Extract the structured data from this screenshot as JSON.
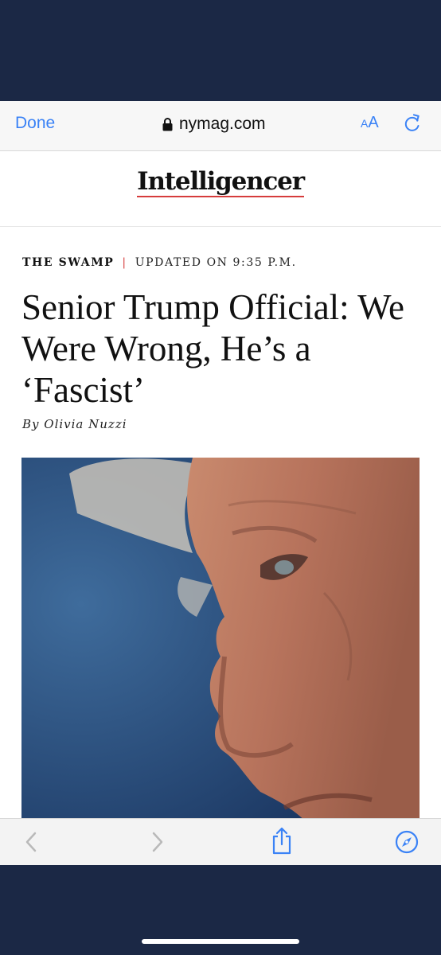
{
  "browser": {
    "done_label": "Done",
    "url": "nymag.com",
    "text_size_small": "A",
    "text_size_big": "A"
  },
  "site": {
    "logo": "Intelligencer"
  },
  "article": {
    "rubric": "THE SWAMP",
    "separator": "|",
    "updated": "UPDATED ON 9:35 P.M.",
    "headline": "Senior Trump Official: We Were Wrong, He’s a ‘Fascist’",
    "byline": "By Olivia Nuzzi"
  },
  "toolbar_icons": [
    "chevron-left-icon",
    "chevron-right-icon",
    "share-icon",
    "compass-icon"
  ],
  "colors": {
    "accent": "#3a82f6",
    "rule_red": "#d63c3c",
    "frame": "#1b2845"
  }
}
